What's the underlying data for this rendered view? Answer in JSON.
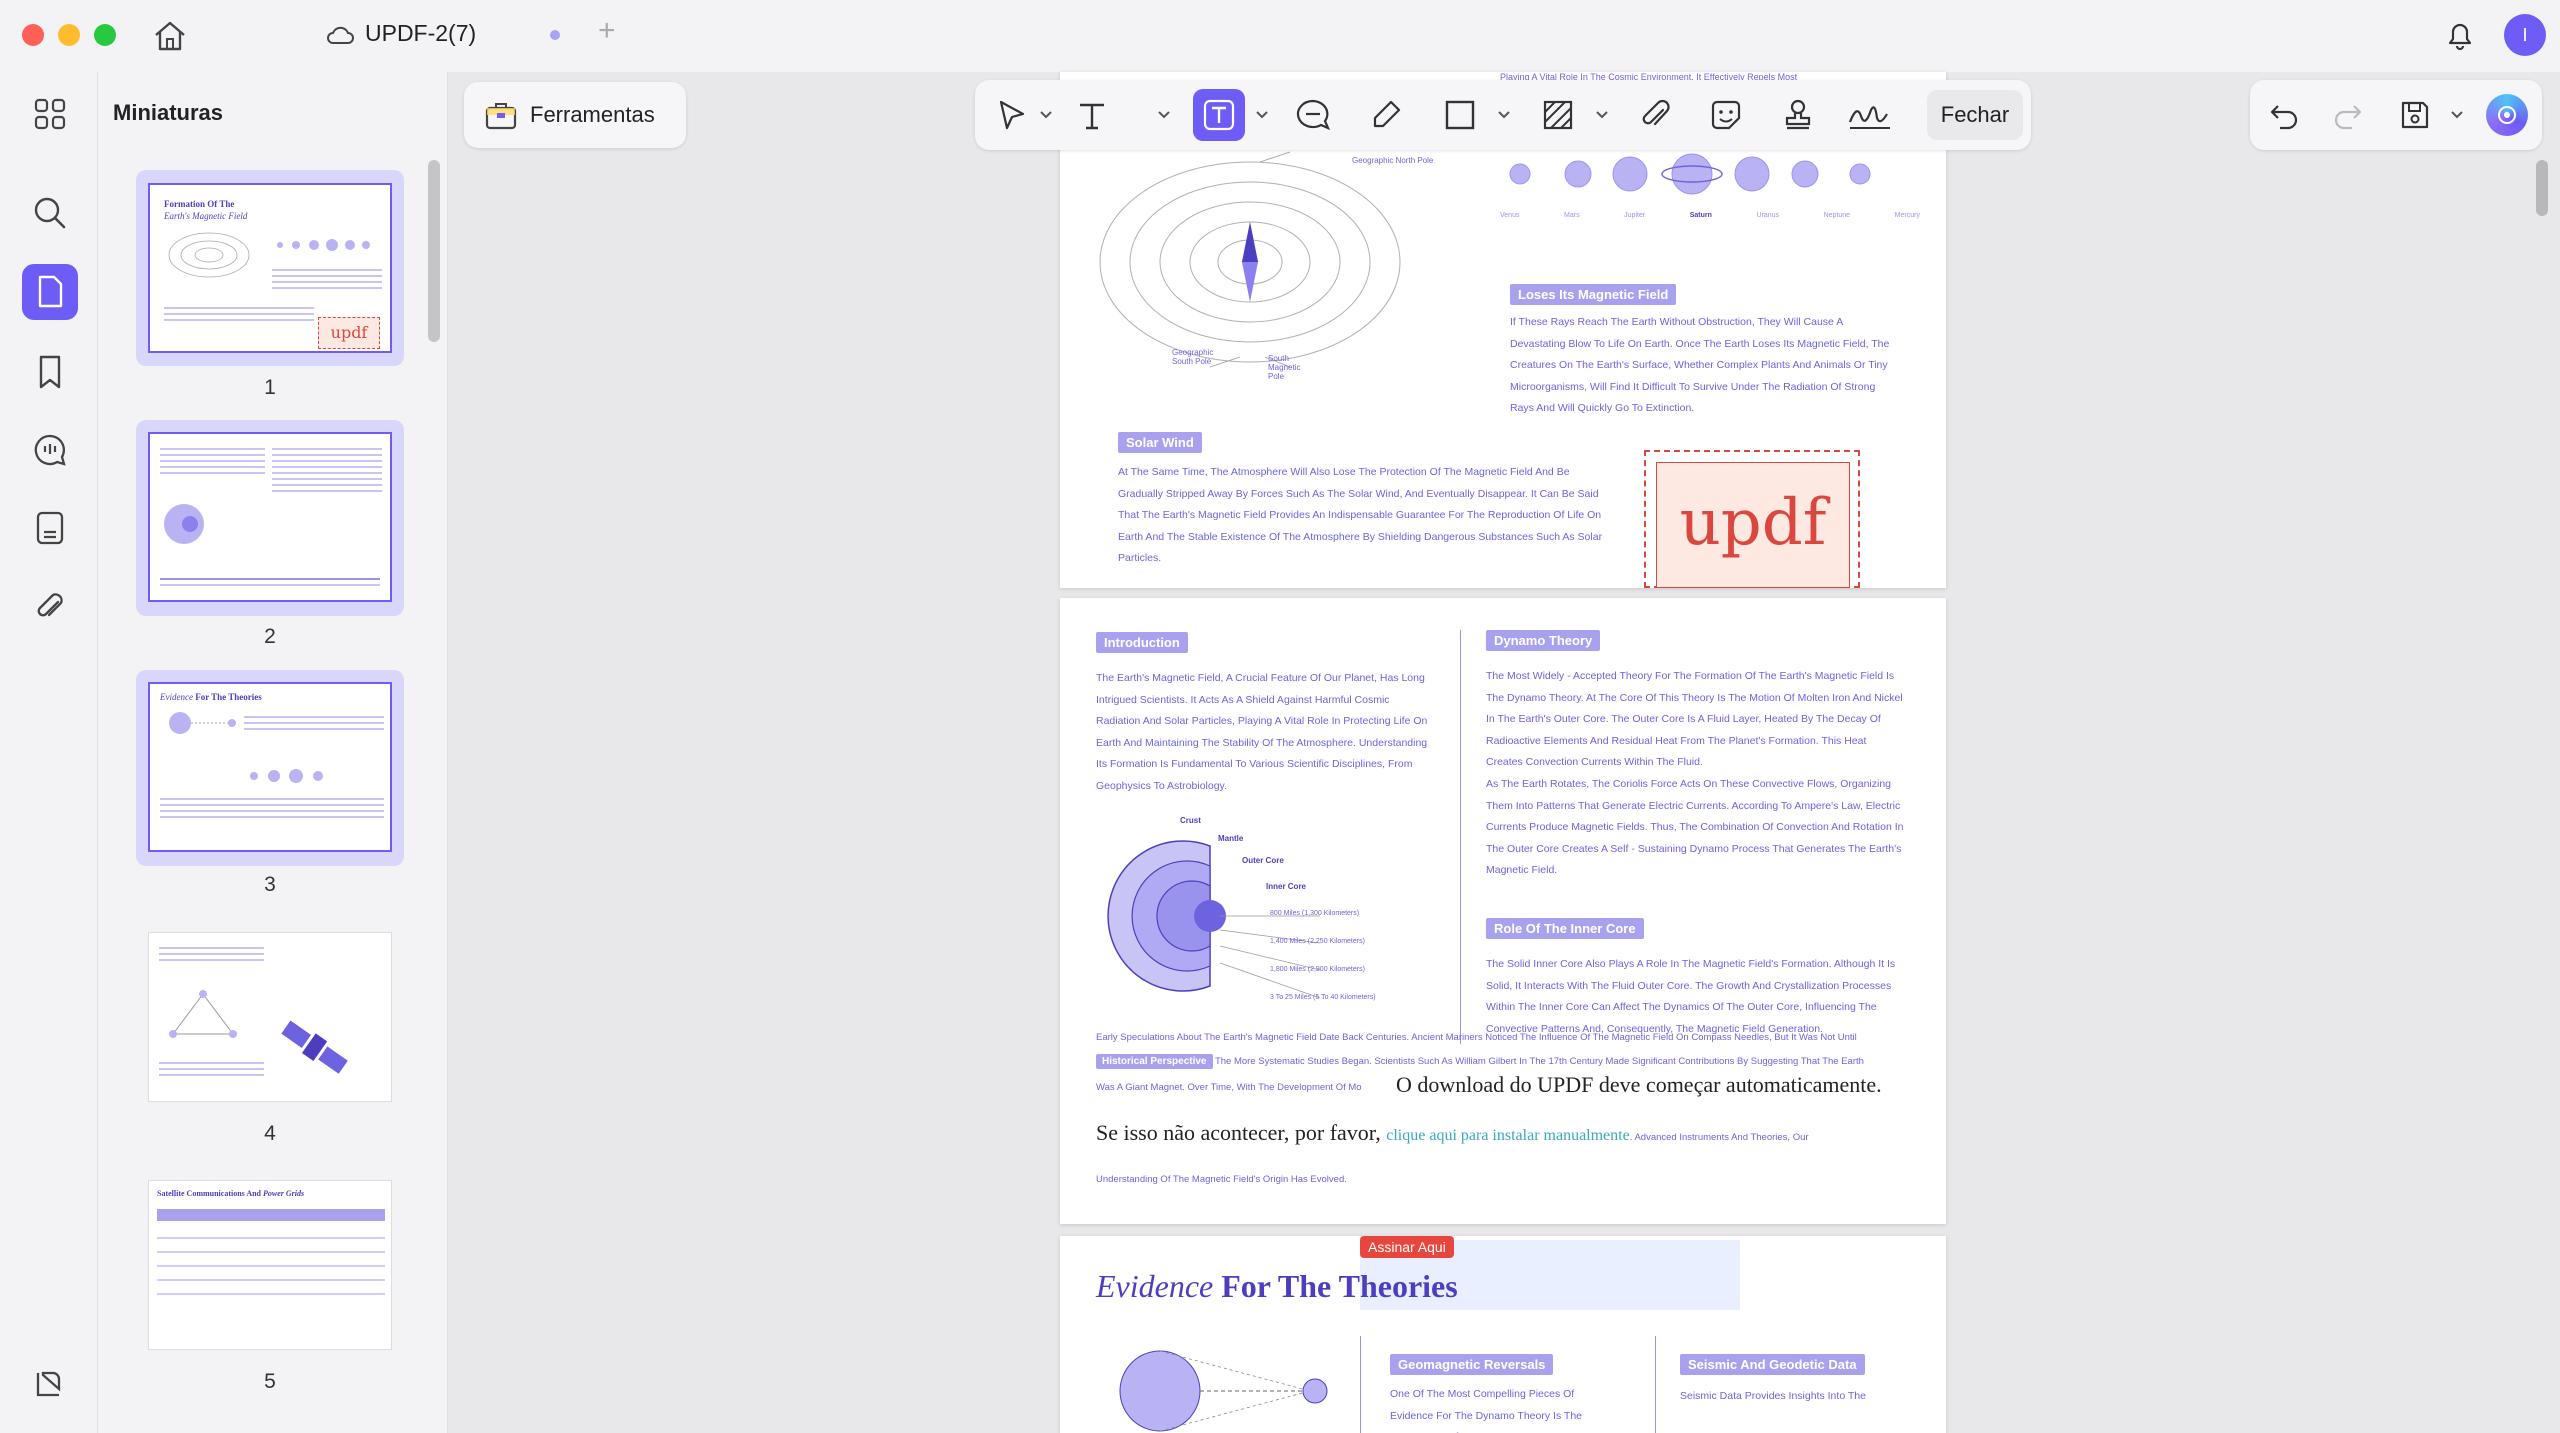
{
  "window": {
    "tab_title": "UPDF-2(7)",
    "user_initial": "I"
  },
  "thumbnails_panel": {
    "title": "Miniaturas",
    "pages": [
      "1",
      "2",
      "3",
      "4",
      "5"
    ],
    "thumb1_title_a": "Formation Of The",
    "thumb1_title_b": "Earth's Magnetic Field",
    "thumb1_stamp": "updf",
    "thumb3_title_a": "Evidence",
    "thumb3_title_b": "For The Theories",
    "thumb5_title_a": "Satellite Communications And",
    "thumb5_title_b": "Power Grids"
  },
  "toolbar": {
    "ferramentas": "Ferramentas",
    "fechar": "Fechar"
  },
  "page1": {
    "planets": [
      "Venus",
      "Mars",
      "Jupiter",
      "Saturn",
      "Uranus",
      "Neptune",
      "Mercury"
    ],
    "diagram_labels": [
      "Geographic North Pole",
      "Geographic South Pole",
      "South Magnetic Pole"
    ],
    "loses_label": "Loses Its Magnetic Field",
    "loses_text": "If These Rays Reach The Earth Without Obstruction, They Will Cause A Devastating Blow To Life On Earth. Once The Earth Loses Its Magnetic Field, The Creatures On The Earth's Surface, Whether Complex Plants And Animals Or Tiny Microorganisms, Will Find It Difficult To Survive Under The Radiation Of Strong Rays And Will Quickly Go To Extinction.",
    "solar_label": "Solar Wind",
    "solar_text": "At The Same Time, The Atmosphere Will Also Lose The Protection Of The Magnetic Field And Be Gradually Stripped Away By Forces Such As The Solar Wind, And Eventually Disappear. It Can Be Said That The Earth's Magnetic Field Provides An Indispensable Guarantee For The Reproduction Of Life On Earth And The Stable Existence Of The Atmosphere By Shielding Dangerous Substances Such As Solar Particles.",
    "stamp": "updf",
    "top_fragment": "Playing A Vital Role In The Cosmic Environment, It Effectively Repels Most"
  },
  "page2": {
    "intro_label": "Introduction",
    "intro_text": "The Earth's Magnetic Field, A Crucial Feature Of Our Planet, Has Long Intrigued Scientists. It Acts As A Shield Against Harmful Cosmic Radiation And Solar Particles, Playing A Vital Role In Protecting Life On Earth And Maintaining The Stability Of The Atmosphere. Understanding Its Formation Is Fundamental To Various Scientific Disciplines, From Geophysics To Astrobiology.",
    "layers": [
      "Crust",
      "Mantle",
      "Outer Core",
      "Inner Core"
    ],
    "distances": [
      "800 Miles (1,300 Kilometers)",
      "1,400 Miles (2,250 Kilometers)",
      "1,800 Miles (2,900 Kilometers)",
      "3 To 25 Miles (5 To 40 Kilometers)"
    ],
    "dynamo_label": "Dynamo Theory",
    "dynamo_text": "The Most Widely - Accepted Theory For The Formation Of The Earth's Magnetic Field Is The Dynamo Theory. At The Core Of This Theory Is The Motion Of Molten Iron And Nickel In The Earth's Outer Core. The Outer Core Is A Fluid Layer, Heated By The Decay Of Radioactive Elements And Residual Heat From The Planet's Formation. This Heat Creates Convection Currents Within The Fluid.",
    "dynamo_text2": "As The Earth Rotates, The Coriolis Force Acts On These Convective Flows, Organizing Them Into Patterns That Generate Electric Currents. According To Ampere's Law, Electric Currents Produce Magnetic Fields. Thus, The Combination Of Convection And Rotation In The Outer Core Creates A Self - Sustaining Dynamo Process That Generates The Earth's Magnetic Field.",
    "inner_label": "Role Of The Inner Core",
    "inner_text": "The Solid Inner Core Also Plays A Role In The Magnetic Field's Formation. Although It Is Solid, It Interacts With The Fluid Outer Core. The Growth And Crystallization Processes Within The Inner Core Can Affect The Dynamics Of The Outer Core, Influencing The Convective Patterns And, Consequently, The Magnetic Field Generation.",
    "early_text": "Early Speculations About The Earth's Magnetic Field Date Back Centuries. Ancient Mariners Noticed The Influence Of The Magnetic Field On Compass Needles, But It Was Not Until",
    "historical_label": "Historical Perspective",
    "early_text2": "The More Systematic Studies Began. Scientists Such As William Gilbert In The 17th Century Made Significant Contributions By Suggesting That The Earth",
    "early_text3": "Was A Giant Magnet. Over Time, With The Development Of Mo",
    "overlay_line1": "O download do UPDF deve começar automaticamente.",
    "overlay_line2_a": "Se isso não acontecer, por favor,",
    "overlay_link": "clique aqui para instalar manualmente",
    "overlay_tail": ". Advanced Instruments And Theories, Our",
    "last_line": "Understanding Of The Magnetic Field's Origin Has Evolved."
  },
  "page3": {
    "sign_badge": "Assinar Aqui",
    "title_italic": "Evidence",
    "title_bold": "For The Theories",
    "geo_label": "Geomagnetic Reversals",
    "geo_text": "One Of The Most Compelling Pieces Of Evidence For The Dynamo Theory Is The Occurrence Of",
    "seismic_label": "Seismic And Geodetic Data",
    "seismic_text": "Seismic Data Provides Insights Into The"
  },
  "colors": {
    "accent": "#6d5cf5",
    "page_text": "#6d63e0",
    "label_bg": "#a8a2ee",
    "stamp_red": "#d9473f"
  }
}
